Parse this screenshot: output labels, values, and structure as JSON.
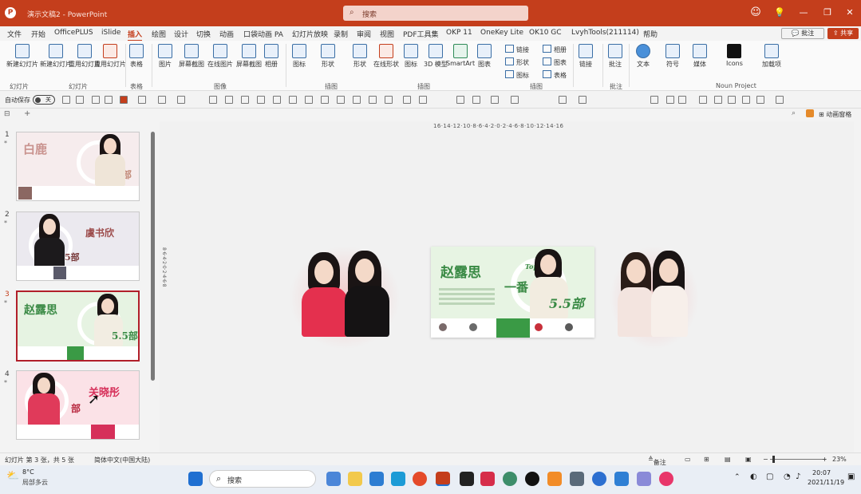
{
  "titlebar": {
    "doc_title": "演示文稿2 - PowerPoint",
    "search_placeholder": "搜索",
    "minimize": "—",
    "restore": "❐",
    "close": "✕"
  },
  "menu": {
    "tabs": [
      "文件",
      "开始",
      "OfficePLUS",
      "iSlide",
      "插入",
      "绘图",
      "设计",
      "切换",
      "动画",
      "口袋动画 PA",
      "幻灯片放映",
      "录制",
      "审阅",
      "视图",
      "PDF工具集",
      "OKP 11",
      "OneKey Lite",
      "OK10 GC",
      "LvyhTools(211114)",
      "帮助"
    ],
    "active_tab": "插入",
    "comment": "批注",
    "share": "共享"
  },
  "ribbon": {
    "new_slide": "新建幻灯片",
    "reuse": "重用幻灯片",
    "table": "表格",
    "picture": "图片",
    "screenshot": "屏幕截图",
    "online_picture": "在线图片",
    "album": "相册",
    "icons": "图标",
    "shapes": "形状",
    "online_shape": "在线形状",
    "model": "3D 模型",
    "smartart": "SmartArt",
    "chart": "图表",
    "link": "链接",
    "comment": "批注",
    "text": "文本",
    "symbols": "符号",
    "media": "媒体",
    "icons_addin": "Icons",
    "addins": "加载项",
    "groups": [
      "幻灯片",
      "表格",
      "图像",
      "插图",
      "链接",
      "批注",
      "加载项"
    ],
    "noun_project": "Noun Project"
  },
  "qat": {
    "autosave": "自动保存",
    "autosave_state": "关"
  },
  "thumbnails": [
    {
      "num": "1",
      "name": "白鹿",
      "tag": "五部",
      "bg": "#f4e8ea"
    },
    {
      "num": "2",
      "name": "虞书欣",
      "tag": "5部",
      "bg": "#eceaf0"
    },
    {
      "num": "3",
      "name": "赵露思",
      "tag": "5.5部",
      "bg": "#e8f5e6"
    },
    {
      "num": "4",
      "name": "关晓彤",
      "tag": "部",
      "bg": "#fbe3e8"
    }
  ],
  "main_slide": {
    "name": "赵露思",
    "big": "一番",
    "number": "5.5部",
    "top_label": "Top"
  },
  "statusbar": {
    "slide_info": "幻灯片 第 3 张，共 5 张",
    "language": "简体中文(中国大陆)",
    "notes": "备注",
    "zoom": "23%"
  },
  "taskbar": {
    "weather_temp": "8°C",
    "weather_desc": "局部多云",
    "search": "搜索",
    "time": "20:07",
    "date": "2021/11/19"
  }
}
